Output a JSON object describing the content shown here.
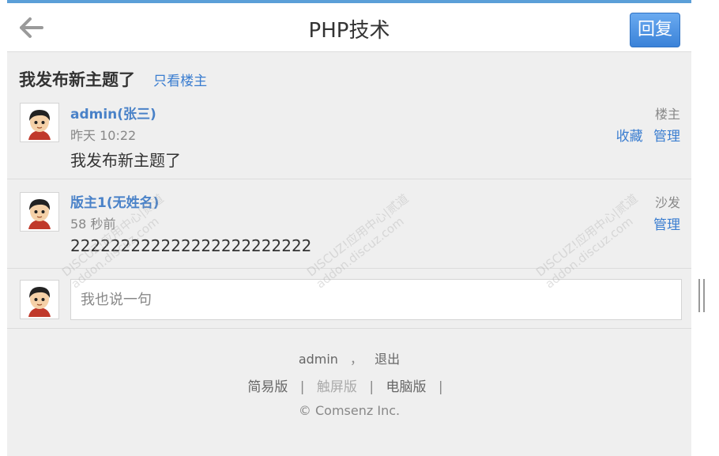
{
  "header": {
    "title": "PHP技术",
    "reply_label": "回复"
  },
  "thread": {
    "title": "我发布新主题了",
    "only_op_label": "只看楼主"
  },
  "posts": [
    {
      "author": "admin(张三)",
      "time": "昨天 10:22",
      "content": "我发布新主题了",
      "floor": "楼主",
      "actions": [
        "收藏",
        "管理"
      ]
    },
    {
      "author": "版主1(无姓名)",
      "time": "58 秒前",
      "content": "222222222222222222222222",
      "floor": "沙发",
      "actions": [
        "管理"
      ]
    }
  ],
  "reply_box": {
    "placeholder": "我也说一句"
  },
  "footer": {
    "user": "admin",
    "comma": "，",
    "logout": "退出",
    "links": [
      "简易版",
      "触屏版",
      "电脑版"
    ],
    "separator": "|",
    "copyright": "© Comsenz Inc."
  },
  "watermark": {
    "line1": "DISCUZ!应用中心|贰道",
    "line2": "addon.discuz.com"
  },
  "colors": {
    "accent": "#3a7dd0",
    "topline": "#5b9fd8",
    "reply_button": "#4a8fe0"
  }
}
